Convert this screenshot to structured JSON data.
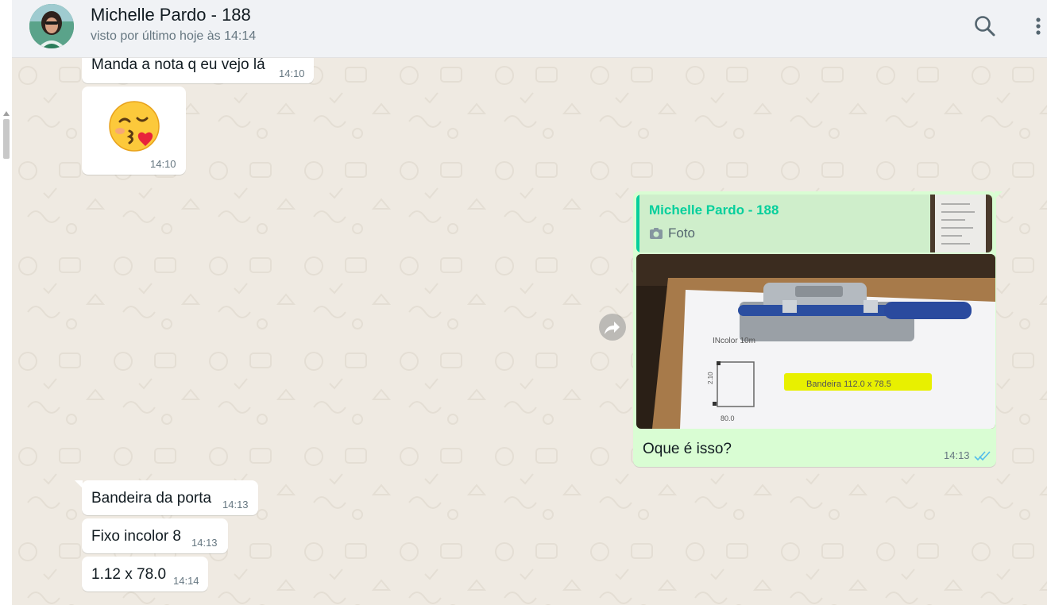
{
  "header": {
    "contact_name": "Michelle Pardo - 188",
    "status": "visto por último hoje às 14:14"
  },
  "icons": {
    "search": "search-icon",
    "menu": "menu-icon",
    "forward": "forward-icon",
    "camera": "camera-icon",
    "read_receipt": "double-check-icon"
  },
  "colors": {
    "incoming_bubble": "#ffffff",
    "outgoing_bubble": "#d9fdd3",
    "quote_accent": "#06cf9c",
    "read_check": "#53bdeb",
    "wallpaper": "#efeae2"
  },
  "messages": [
    {
      "direction": "in",
      "text": "Manda a nota q eu vejo lá",
      "time": "14:10"
    },
    {
      "direction": "in",
      "emoji": "😚",
      "time": "14:10"
    },
    {
      "direction": "out",
      "reply_to": {
        "author": "Michelle Pardo - 188",
        "type": "Foto"
      },
      "photo_text": {
        "left": "INcolor 10m",
        "right": "Bandeira  112.0 x 78.5",
        "side": "2.10",
        "bottom": "80.0"
      },
      "text": "Oque é isso?",
      "time": "14:13",
      "status": "read"
    },
    {
      "direction": "in",
      "text": "Bandeira da porta",
      "time": "14:13"
    },
    {
      "direction": "in",
      "text": "Fixo incolor 8",
      "time": "14:13"
    },
    {
      "direction": "in",
      "text": "1.12 x 78.0",
      "time": "14:14"
    }
  ]
}
